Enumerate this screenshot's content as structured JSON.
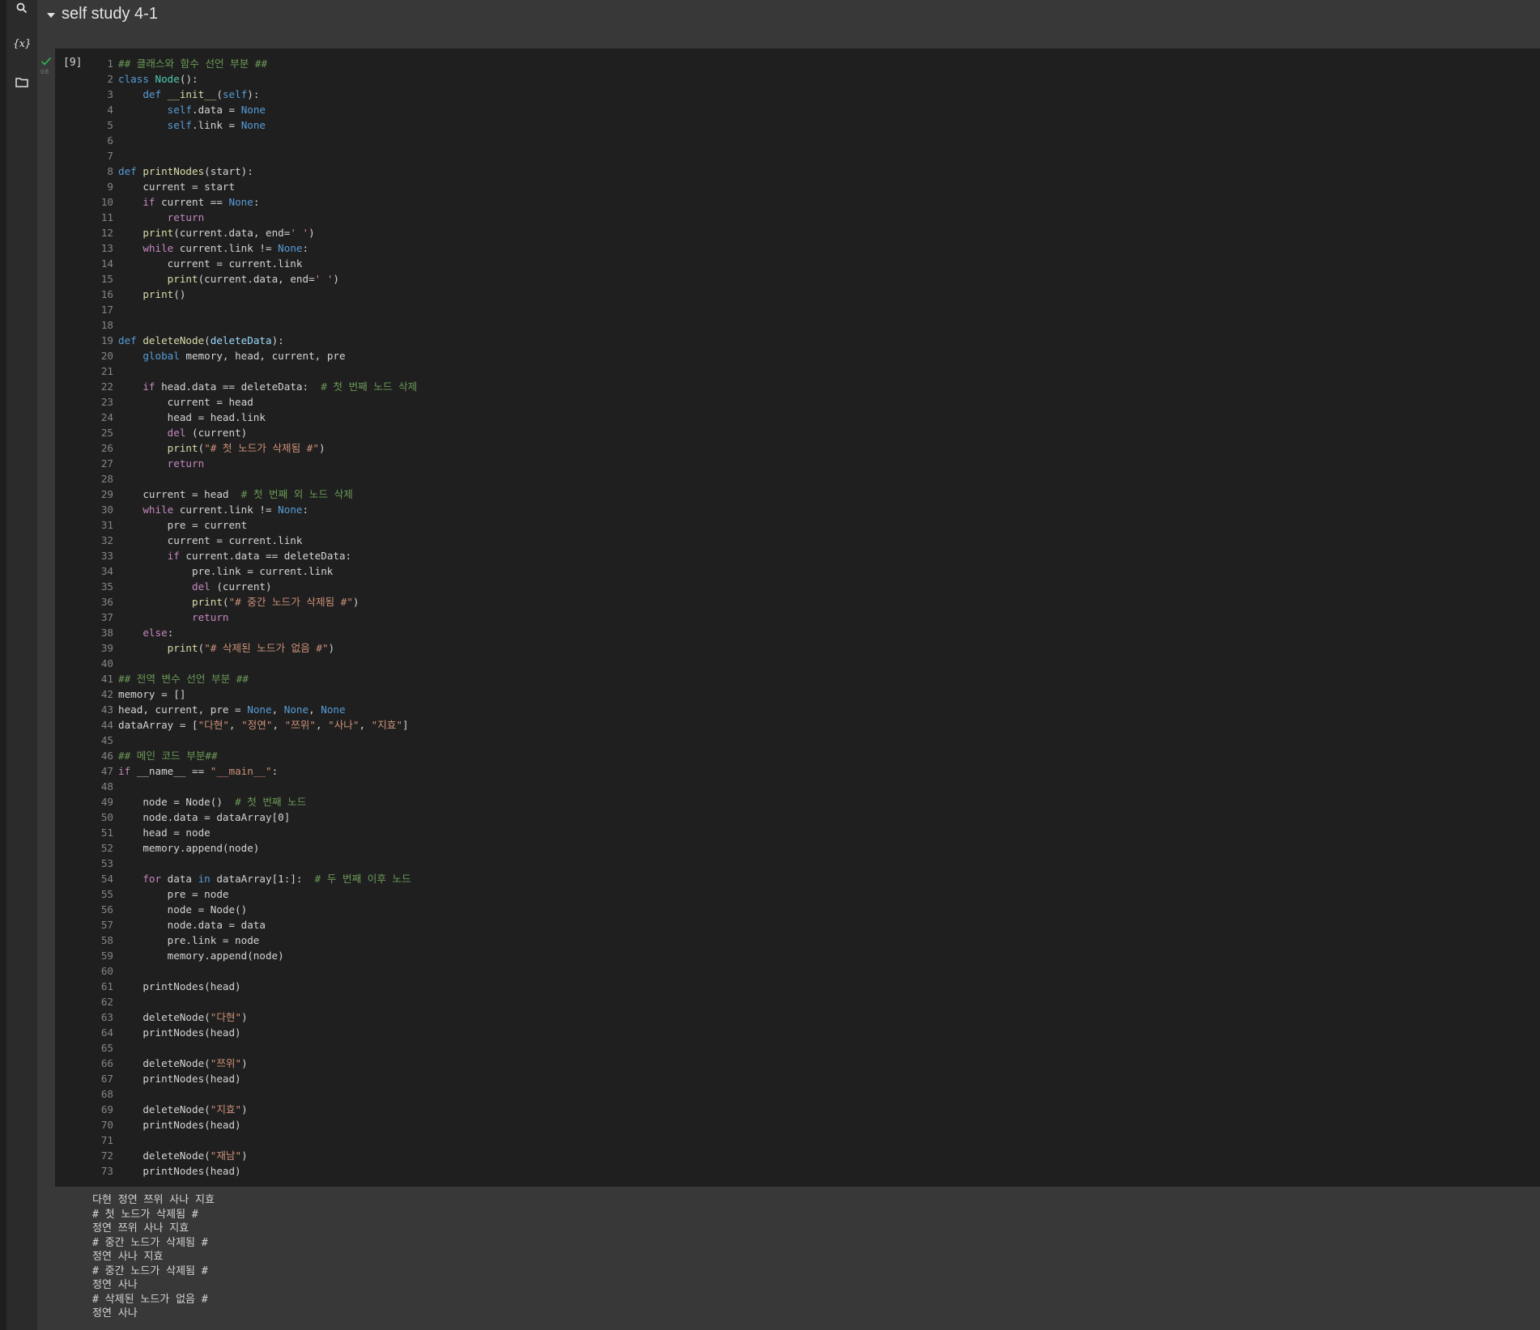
{
  "sidebar": {
    "items": [
      {
        "name": "search",
        "icon": "search-icon"
      },
      {
        "name": "variables",
        "icon": "variables-icon",
        "label": "{x}"
      },
      {
        "name": "files",
        "icon": "folder-icon"
      }
    ]
  },
  "section": {
    "title": "self study 4-1",
    "expanded": true
  },
  "cell": {
    "execution_count": "[9]",
    "status": "success",
    "status_icon": "check-icon",
    "run_time": "0초",
    "code_lines": [
      "## 클래스와 함수 선언 부분 ##",
      "class Node():",
      "    def __init__(self):",
      "        self.data = None",
      "        self.link = None",
      "",
      "",
      "def printNodes(start):",
      "    current = start",
      "    if current == None:",
      "        return",
      "    print(current.data, end=' ')",
      "    while current.link != None:",
      "        current = current.link",
      "        print(current.data, end=' ')",
      "    print()",
      "",
      "",
      "def deleteNode(deleteData):",
      "    global memory, head, current, pre",
      "",
      "    if head.data == deleteData:  # 첫 번째 노드 삭제",
      "        current = head",
      "        head = head.link",
      "        del (current)",
      "        print(\"# 첫 노드가 삭제됨 #\")",
      "        return",
      "",
      "    current = head  # 첫 번째 외 노드 삭제",
      "    while current.link != None:",
      "        pre = current",
      "        current = current.link",
      "        if current.data == deleteData:",
      "            pre.link = current.link",
      "            del (current)",
      "            print(\"# 중간 노드가 삭제됨 #\")",
      "            return",
      "    else:",
      "        print(\"# 삭제된 노드가 없음 #\")",
      "",
      "## 전역 변수 선언 부분 ##",
      "memory = []",
      "head, current, pre = None, None, None",
      "dataArray = [\"다현\", \"정연\", \"쯔위\", \"사나\", \"지효\"]",
      "",
      "## 메인 코드 부분##",
      "if __name__ == \"__main__\":",
      "",
      "    node = Node()  # 첫 번째 노드",
      "    node.data = dataArray[0]",
      "    head = node",
      "    memory.append(node)",
      "",
      "    for data in dataArray[1:]:  # 두 번째 이후 노드",
      "        pre = node",
      "        node = Node()",
      "        node.data = data",
      "        pre.link = node",
      "        memory.append(node)",
      "",
      "    printNodes(head)",
      "",
      "    deleteNode(\"다현\")",
      "    printNodes(head)",
      "",
      "    deleteNode(\"쯔위\")",
      "    printNodes(head)",
      "",
      "    deleteNode(\"지효\")",
      "    printNodes(head)",
      "",
      "    deleteNode(\"재남\")",
      "    printNodes(head)"
    ],
    "output_lines": [
      "다현 정연 쯔위 사나 지효",
      "# 첫 노드가 삭제됨 #",
      "정연 쯔위 사나 지효",
      "# 중간 노드가 삭제됨 #",
      "정연 사나 지효",
      "# 중간 노드가 삭제됨 #",
      "정연 사나",
      "# 삭제된 노드가 없음 #",
      "정연 사나"
    ]
  },
  "colors": {
    "background": "#383838",
    "code_background": "#1f1f1f",
    "success": "#34a853",
    "keyword": "#569cd6",
    "control": "#c586c0",
    "function": "#dcdcaa",
    "string": "#ce9178",
    "comment": "#6a9955"
  }
}
